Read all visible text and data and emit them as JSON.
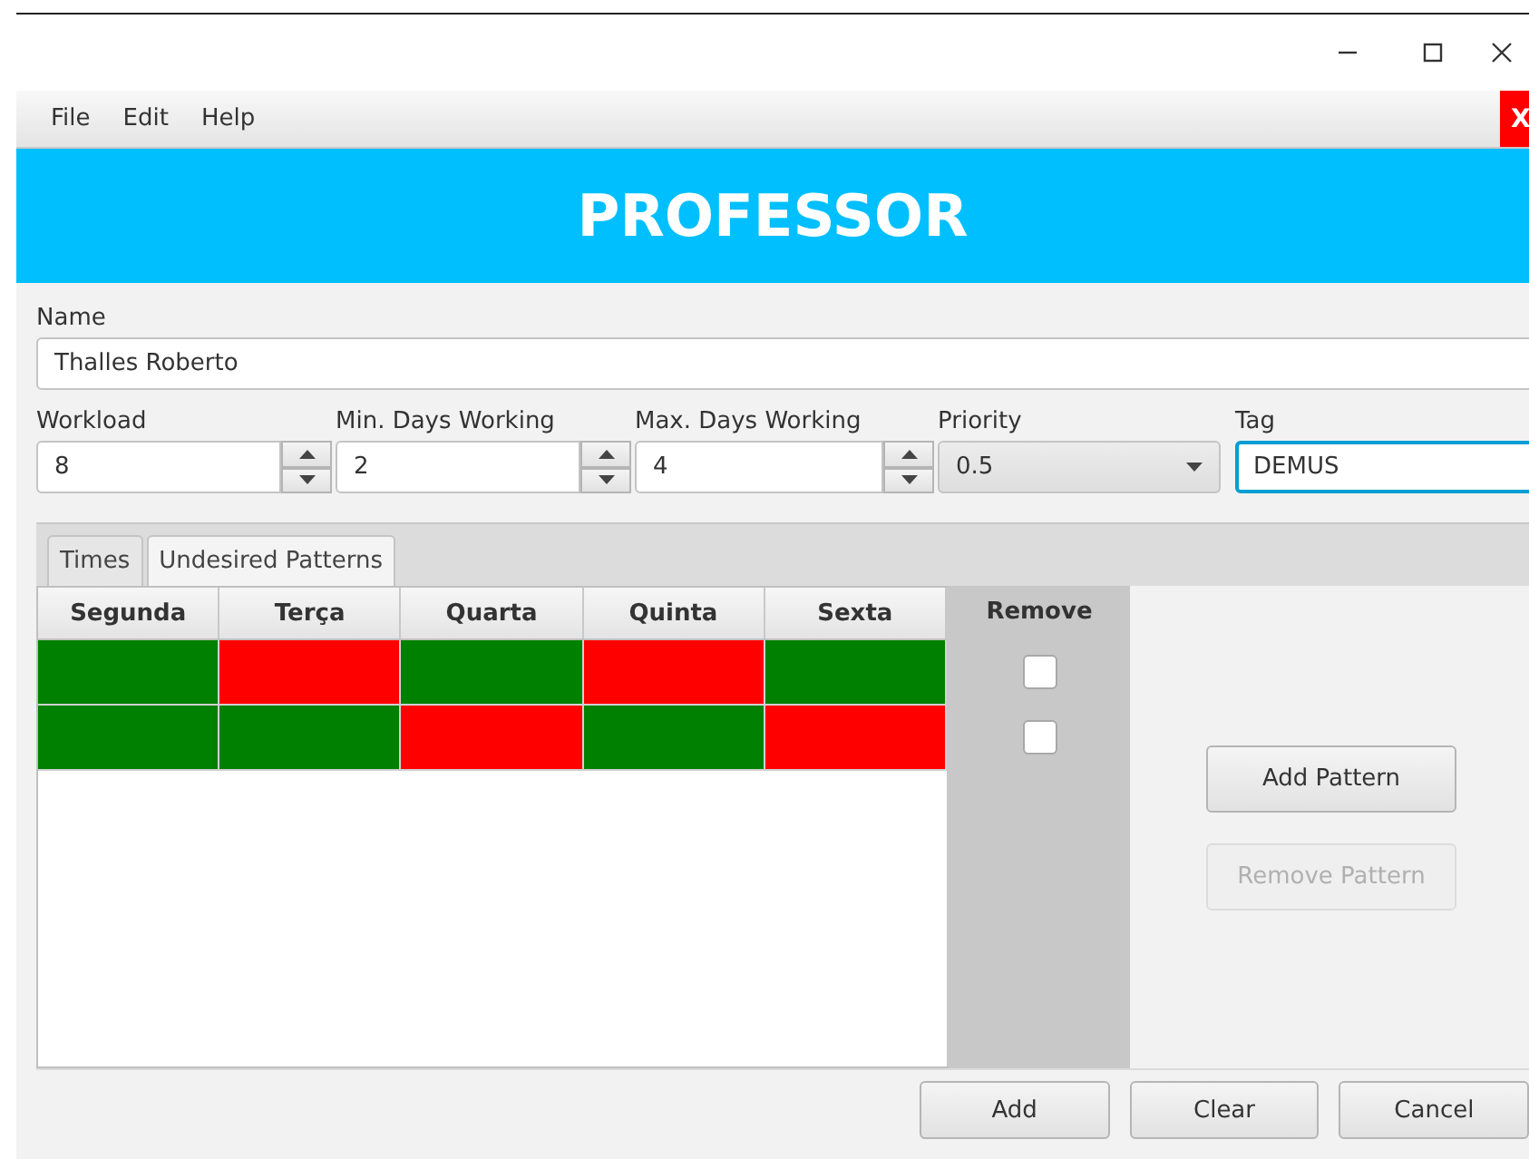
{
  "window": {
    "close_badge": "X"
  },
  "menu": [
    {
      "label": "File"
    },
    {
      "label": "Edit"
    },
    {
      "label": "Help"
    }
  ],
  "header": {
    "title": "PROFESSOR"
  },
  "form": {
    "name": {
      "label": "Name",
      "value": "Thalles Roberto"
    },
    "fields": [
      {
        "kind": "spinner",
        "label": "Workload",
        "value": "8",
        "focused": false
      },
      {
        "kind": "spinner",
        "label": "Min. Days Working",
        "value": "2",
        "focused": false
      },
      {
        "kind": "spinner",
        "label": "Max. Days Working",
        "value": "4",
        "focused": false
      },
      {
        "kind": "combo",
        "label": "Priority",
        "value": "0.5",
        "focused": false
      },
      {
        "kind": "text",
        "label": "Tag",
        "value": "DEMUS",
        "focused": true
      }
    ]
  },
  "tabs": [
    {
      "label": "Times",
      "selected": false
    },
    {
      "label": "Undesired Patterns",
      "selected": true
    }
  ],
  "table": {
    "columns": [
      "Segunda",
      "Terça",
      "Quarta",
      "Quinta",
      "Sexta"
    ],
    "remove_column": "Remove",
    "rows": [
      {
        "cells": [
          {
            "color": "#008000"
          },
          {
            "color": "#ff0000"
          },
          {
            "color": "#008000"
          },
          {
            "color": "#ff0000"
          },
          {
            "color": "#008000"
          }
        ],
        "remove_checked": false
      },
      {
        "cells": [
          {
            "color": "#008000"
          },
          {
            "color": "#008000"
          },
          {
            "color": "#ff0000"
          },
          {
            "color": "#008000"
          },
          {
            "color": "#ff0000"
          }
        ],
        "remove_checked": false
      }
    ]
  },
  "pattern_buttons": [
    {
      "label": "Add Pattern",
      "disabled": false
    },
    {
      "label": "Remove Pattern",
      "disabled": true
    }
  ],
  "footer_buttons": [
    {
      "label": "Add"
    },
    {
      "label": "Clear"
    },
    {
      "label": "Cancel"
    }
  ]
}
